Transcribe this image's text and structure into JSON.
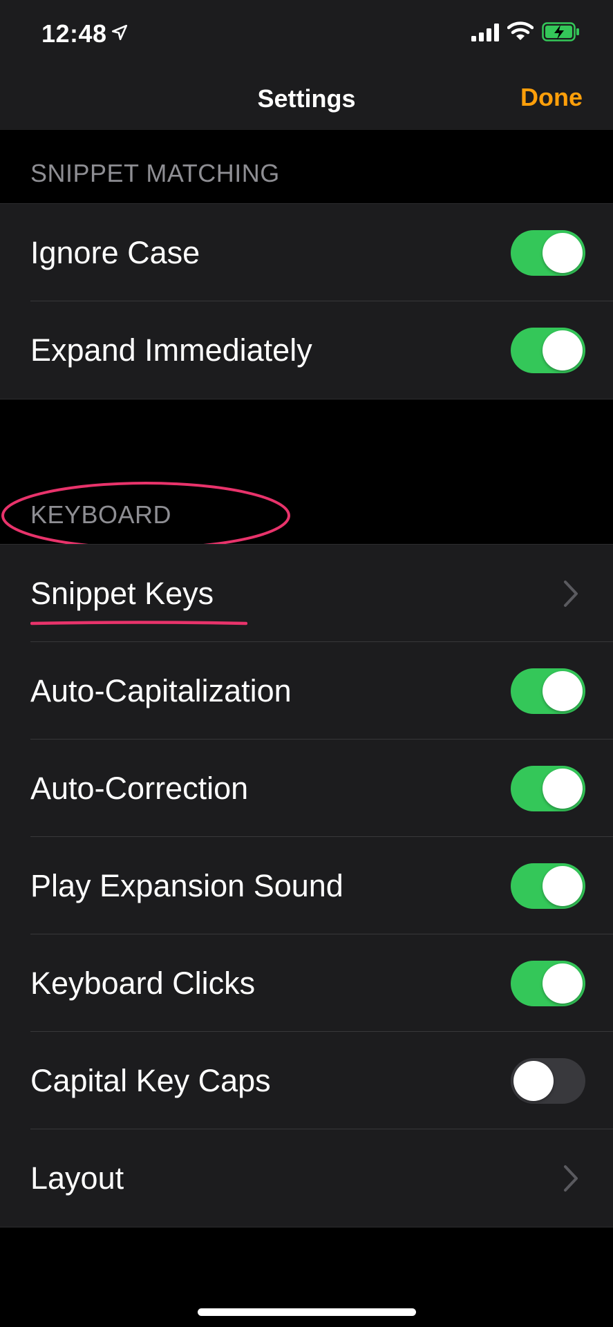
{
  "status_bar": {
    "time": "12:48",
    "icons": [
      "location-arrow-icon",
      "cellular-signal-icon",
      "wifi-icon",
      "battery-charging-icon"
    ]
  },
  "nav": {
    "title": "Settings",
    "done_label": "Done"
  },
  "sections": {
    "snippet_matching": {
      "header": "SNIPPET MATCHING",
      "rows": [
        {
          "label": "Ignore Case",
          "control": "toggle",
          "on": true
        },
        {
          "label": "Expand Immediately",
          "control": "toggle",
          "on": true
        }
      ]
    },
    "keyboard": {
      "header": "KEYBOARD",
      "rows": [
        {
          "label": "Snippet Keys",
          "control": "chevron"
        },
        {
          "label": "Auto-Capitalization",
          "control": "toggle",
          "on": true
        },
        {
          "label": "Auto-Correction",
          "control": "toggle",
          "on": true
        },
        {
          "label": "Play Expansion Sound",
          "control": "toggle",
          "on": true
        },
        {
          "label": "Keyboard Clicks",
          "control": "toggle",
          "on": true
        },
        {
          "label": "Capital Key Caps",
          "control": "toggle",
          "on": false
        },
        {
          "label": "Layout",
          "control": "chevron"
        }
      ]
    }
  },
  "colors": {
    "accent": "#ff9f0a",
    "toggle_on": "#34c759",
    "toggle_off": "#39393d",
    "annotation": "#e8336b",
    "cell_background": "#1c1c1e",
    "page_background": "#000000"
  }
}
